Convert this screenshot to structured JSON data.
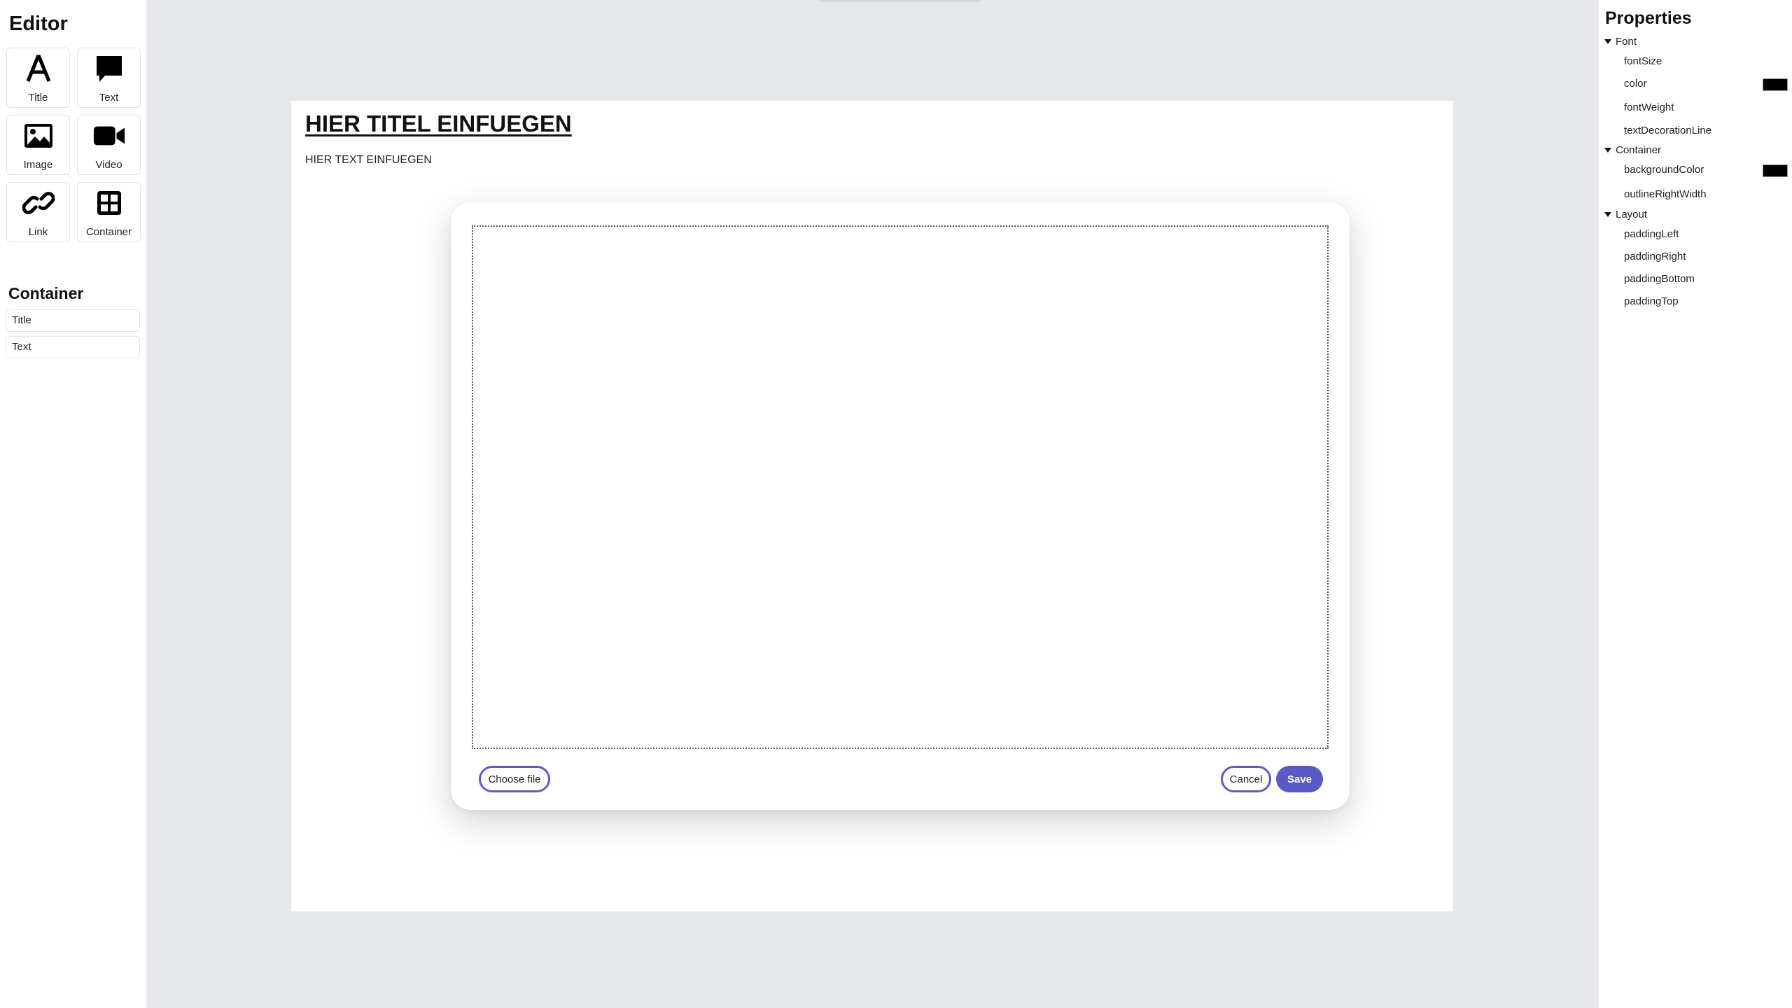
{
  "editor": {
    "title": "Editor",
    "tools": [
      {
        "label": "Title",
        "icon": "title-icon"
      },
      {
        "label": "Text",
        "icon": "comment-icon"
      },
      {
        "label": "Image",
        "icon": "image-icon"
      },
      {
        "label": "Video",
        "icon": "video-icon"
      },
      {
        "label": "Link",
        "icon": "link-icon"
      },
      {
        "label": "Container",
        "icon": "grid-icon"
      }
    ],
    "layers_title": "Container",
    "layers": [
      "Title",
      "Text"
    ]
  },
  "page": {
    "title": "HIER TITEL EINFUEGEN",
    "text": "HIER TEXT EINFUEGEN"
  },
  "modal": {
    "choose_file_label": "Choose file",
    "cancel_label": "Cancel",
    "save_label": "Save"
  },
  "properties": {
    "title": "Properties",
    "groups": [
      {
        "name": "Font",
        "items": [
          "fontSize",
          "color",
          "fontWeight",
          "textDecorationLine"
        ]
      },
      {
        "name": "Container",
        "items": [
          "backgroundColor",
          "outlineRightWidth"
        ]
      },
      {
        "name": "Layout",
        "items": [
          "paddingLeft",
          "paddingRight",
          "paddingBottom",
          "paddingTop"
        ]
      }
    ],
    "color_value": "#000000",
    "background_color_value": "#000000"
  },
  "colors": {
    "accent": "#5a5ac6",
    "canvas_bg": "#e5e7eb",
    "panel_bg": "#ffffff"
  }
}
